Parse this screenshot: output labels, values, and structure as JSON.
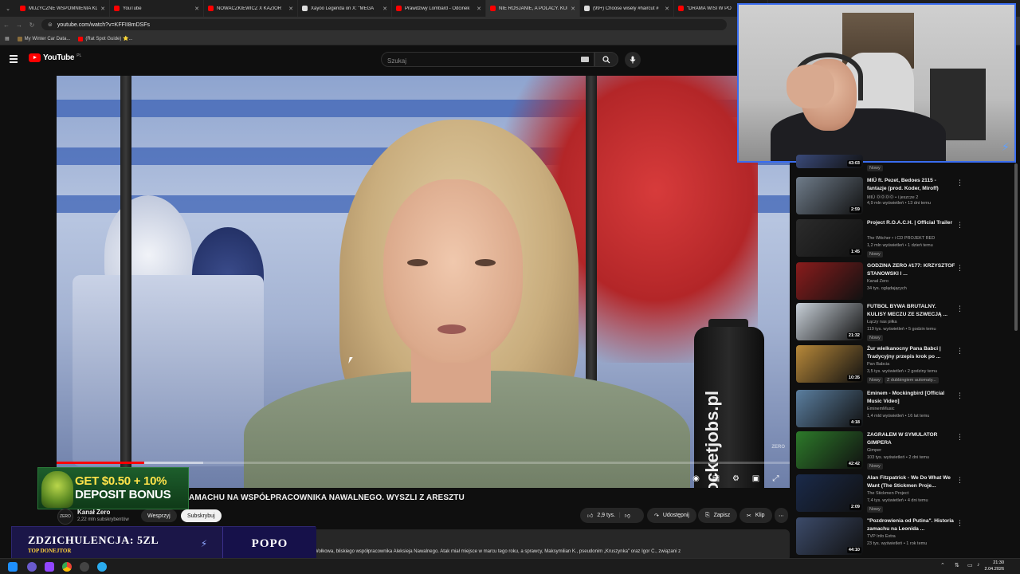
{
  "browser": {
    "tabs": [
      {
        "title": "MUZYCZNE WSPOMNIENIA KL",
        "color": "#ff0000"
      },
      {
        "title": "YouTube",
        "color": "#ff0000"
      },
      {
        "title": "NOWACZKIEWICZ X KAZIOR",
        "color": "#ff0000"
      },
      {
        "title": "Xayoo Legenda on X: \"MEGA",
        "color": "#dddddd"
      },
      {
        "title": "Prawdziwy Lombard - Odcinek",
        "color": "#ff0000"
      },
      {
        "title": "NIE ROSJANIE, A POLACY. KULI",
        "color": "#ff0000"
      },
      {
        "title": "(99+) Choose wisely #haircut #",
        "color": "#dddddd"
      },
      {
        "title": "\"DRAMA WISI W PO",
        "color": "#ff0000"
      }
    ],
    "url": "youtube.com/watch?v=KFFII8mDSFs",
    "bookmarks": [
      "My Winter Car Data...",
      "(Rat Spot Guide) ⭐..."
    ]
  },
  "youtube": {
    "logo_text": "YouTube",
    "logo_region": "PL",
    "search_placeholder": "Szukaj"
  },
  "video": {
    "title": "AMACHU NA WSPÓŁPRACOWNIKA NAWALNEGO. WYSZLI Z ARESZTU",
    "bottle_text": "rocketjobs.pl",
    "watermark": "ZERO",
    "progress_played": 0.12,
    "progress_buffered": 0.2,
    "channel_avatar_text": "ZERO",
    "channel": "Kanał Zero",
    "subscribers": "2,22 mln subskrybentów",
    "support_label": "Wesprzyj",
    "subscribe_label": "Subskrybuj",
    "likes": "2,9 tys.",
    "share_label": "Udostępnij",
    "save_label": "Zapisz",
    "clip_label": "Klip",
    "description_snippet": "Wołkowa, bliskiego współpracownika Aleksieja Nawalnego. Atak miał miejsce w marcu tego roku, a sprawcy, Maksymilian K., pseudonim „Kruszynka\" oraz Igor C., związani z"
  },
  "ad": {
    "line1": "GET $0.50 + 10%",
    "line2": "DEPOSIT BONUS"
  },
  "donation": {
    "main": "ZDZICHULENCJA: 5ZL",
    "sub": "TOP DONEJTOR",
    "right": "POPO"
  },
  "sidebar": {
    "items": [
      {
        "title": "",
        "channel": "",
        "meta": "",
        "badge": "Nowy",
        "duration": "43:03",
        "thumb": "#3a4a7a",
        "top_duration": true
      },
      {
        "title": "MIÜ ft. Pezet, Bedoes 2115 - fantazje (prod. Koder, Miroff)",
        "channel": "MIÜ ⓄⓄⓄⓄ • i jeszcze 2",
        "meta": "4,9 mln wyświetleń • 13 dni temu",
        "badge": "",
        "duration": "2:59",
        "thumb": "#6f7c8a"
      },
      {
        "title": "Project R.O.A.C.H. | Official Trailer",
        "channel": "The Witcher • i CD PROJEKT RED",
        "meta": "1,2 mln wyświetleń • 1 dzień temu",
        "badge": "Nowy",
        "duration": "1:45",
        "thumb": "#2c2c2c"
      },
      {
        "title": "GODZINA ZERO #177: KRZYSZTOF STANOWSKI I ...",
        "channel": "Kanał Zero",
        "meta": "34 tys. oglądających",
        "badge": "",
        "duration": "",
        "thumb": "#8a1c1c"
      },
      {
        "title": "FUTBOL BYWA BRUTALNY. KULISY MECZU ZE SZWECJĄ ...",
        "channel": "Łączy nas piłka",
        "meta": "119 tys. wyświetleń • 5 godzin temu",
        "badge": "Nowy",
        "duration": "21:32",
        "thumb": "#c8d0d8"
      },
      {
        "title": "Żur wielkanocny Pana Babci | Tradycyjny przepis krok po ...",
        "channel": "Pan Babcia",
        "meta": "3,5 tys. wyświetleń • 2 godziny temu",
        "badge": "Nowy",
        "badge2": "Z dubbingiem automaty...",
        "duration": "10:35",
        "thumb": "#b8893a"
      },
      {
        "title": "Eminem - Mockingbird [Official Music Video]",
        "channel": "EminemMusic",
        "meta": "1,4 mld wyświetleń • 16 lat temu",
        "badge": "",
        "duration": "4:18",
        "thumb": "#5b7fa0"
      },
      {
        "title": "ZAGRAŁEM W SYMULATOR GIMPERA",
        "channel": "Gimper",
        "meta": "103 tys. wyświetleń • 2 dni temu",
        "badge": "Nowy",
        "duration": "42:42",
        "thumb": "#2d7a2a"
      },
      {
        "title": "Alan Fitzpatrick - We Do What We Want (The Stickmen Proje...",
        "channel": "The Stickmen Project",
        "meta": "7,4 tys. wyświetleń • 4 dni temu",
        "badge": "Nowy",
        "duration": "2:09",
        "thumb": "#1a2a4a"
      },
      {
        "title": "\"Pozdrowienia od Putina\". Historia zamachu na Leonida ...",
        "channel": "TVP Info Extra",
        "meta": "23 tys. wyświetleń • 1 rok temu",
        "badge": "",
        "duration": "44:10",
        "thumb": "#3c4b6a"
      }
    ]
  },
  "taskbar": {
    "time": "21:30",
    "date": "2.04.2026"
  },
  "colors": {
    "accent": "#ff0000",
    "bg": "#0f0f0f",
    "webcam_border": "#3a6df0"
  }
}
